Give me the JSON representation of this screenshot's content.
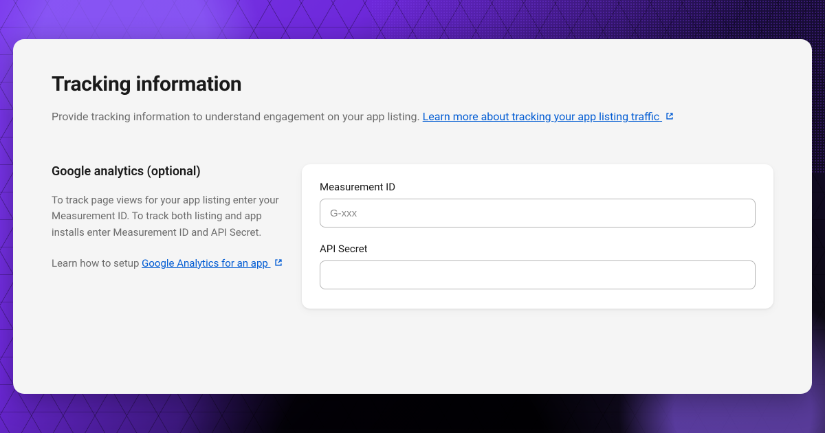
{
  "header": {
    "title": "Tracking information",
    "subtitle_prefix": "Provide tracking information to understand engagement on your app listing. ",
    "learn_more_link": "Learn more about tracking your app listing traffic"
  },
  "section": {
    "title": "Google analytics (optional)",
    "description": "To track page views for your app listing enter your Measurement ID. To track both listing and app installs enter Measurement ID and API Secret.",
    "help_prefix": "Learn how to setup ",
    "help_link": "Google Analytics for an app"
  },
  "form": {
    "measurement": {
      "label": "Measurement ID",
      "placeholder": "G-xxx",
      "value": ""
    },
    "api_secret": {
      "label": "API Secret",
      "placeholder": "",
      "value": ""
    }
  },
  "colors": {
    "link": "#005bd3",
    "card_bg": "#f5f5f5",
    "form_bg": "#ffffff"
  }
}
